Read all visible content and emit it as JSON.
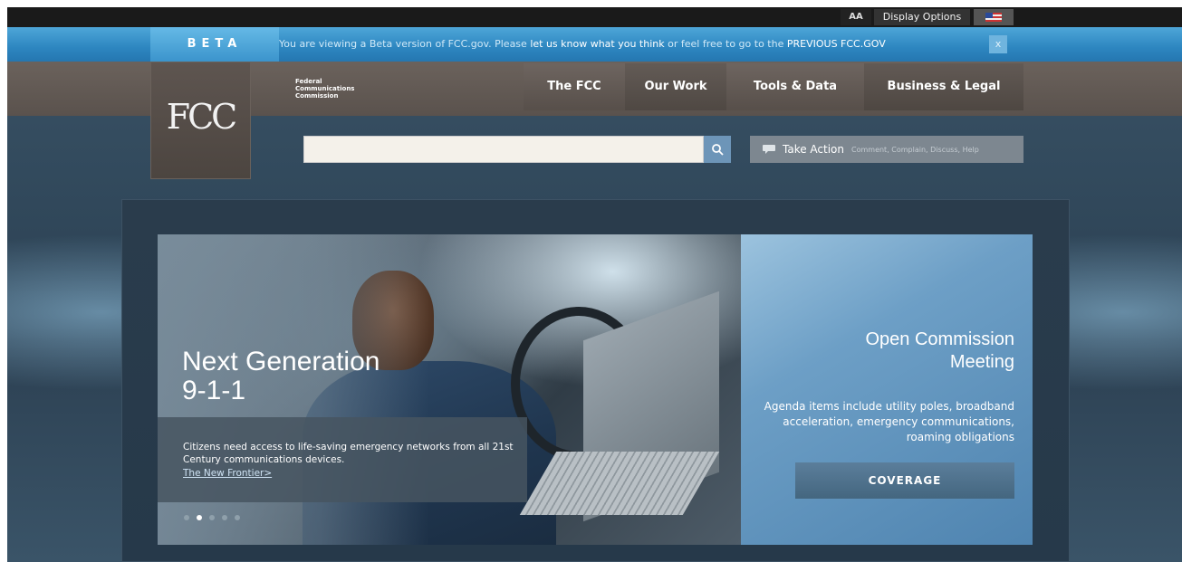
{
  "utility": {
    "text_size_label": "AA",
    "display_options_label": "Display Options",
    "flag_icon": "us-flag-icon"
  },
  "beta": {
    "label": "BETA",
    "msg_prefix": "You are viewing a Beta version of FCC.gov. Please ",
    "msg_link1": "let us know what you think",
    "msg_mid": " or feel free to go to the ",
    "msg_link2": "PREVIOUS FCC.GOV",
    "close_label": "x"
  },
  "header": {
    "logo_text": "FCC",
    "agency_line1": "Federal",
    "agency_line2": "Communications",
    "agency_line3": "Commission"
  },
  "nav": {
    "items": [
      "The FCC",
      "Our Work",
      "Tools & Data",
      "Business & Legal"
    ]
  },
  "search": {
    "value": "",
    "placeholder": "",
    "icon": "search-icon"
  },
  "take_action": {
    "label": "Take Action",
    "sub": "Comment, Complain, Discuss, Help",
    "icon": "speech-bubble-icon"
  },
  "hero": {
    "title_line1": "Next Generation",
    "title_line2": "9-1-1",
    "caption": "Citizens need access to life-saving emergency networks from all 21st Century communications devices.",
    "link": "The New Frontier>",
    "active_slide": 2,
    "slide_count": 5
  },
  "side": {
    "title_line1": "Open Commission",
    "title_line2": "Meeting",
    "text": "Agenda items include utility poles, broadband acceleration, emergency communications, roaming obligations",
    "button": "COVERAGE"
  },
  "colors": {
    "beta_blue": "#2d86c0",
    "nav_brown": "#5a524d",
    "panel_blue": "#6d9fc6"
  }
}
